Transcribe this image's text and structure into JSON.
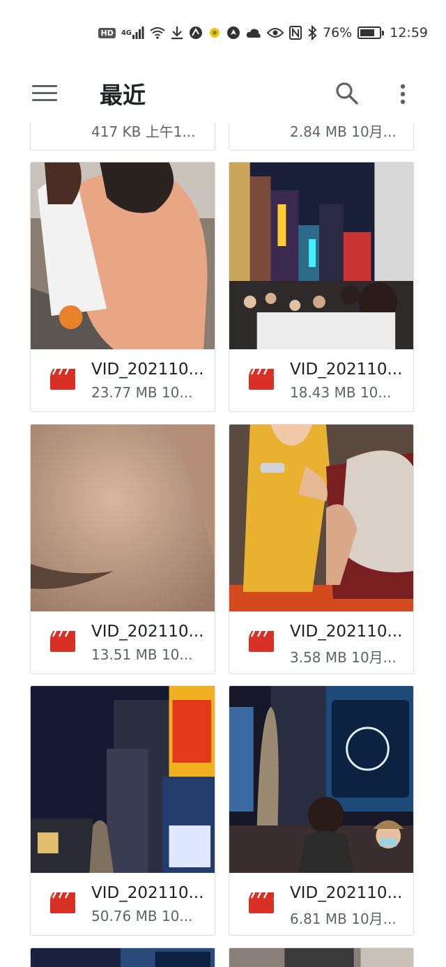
{
  "status_bar": {
    "hd": "HD",
    "network": "4G",
    "battery_percent": "76%",
    "battery_level": 0.76,
    "time": "12:59"
  },
  "app_bar": {
    "title": "最近"
  },
  "partial_top_row": [
    {
      "meta": "417 KB 上午1..."
    },
    {
      "meta": "2.84 MB 10月..."
    }
  ],
  "files": [
    {
      "name": "VID_202110...",
      "meta": "23.77 MB 10..."
    },
    {
      "name": "VID_202110...",
      "meta": "18.43 MB 10..."
    },
    {
      "name": "VID_202110...",
      "meta": "13.51 MB 10..."
    },
    {
      "name": "VID_202110...",
      "meta": "3.58 MB 10月..."
    },
    {
      "name": "VID_202110...",
      "meta": "50.76 MB 10..."
    },
    {
      "name": "VID_202110...",
      "meta": "6.81 MB 10月..."
    }
  ],
  "colors": {
    "video_icon": "#d93025",
    "title_text": "#202124",
    "meta_text": "#5f6368"
  }
}
